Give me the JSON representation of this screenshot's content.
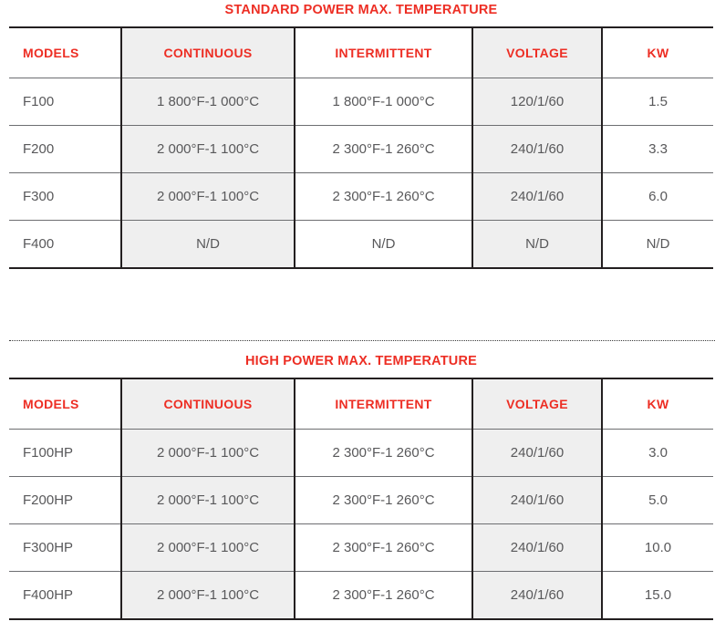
{
  "page": {
    "background": "#ffffff",
    "accent_red": "#ED2E24",
    "text_gray": "#58585A",
    "shaded_cell": "#EFEFEF",
    "border_dark": "#231F20"
  },
  "divider": {
    "style": "dotted"
  },
  "tables": [
    {
      "id": "standard",
      "title": "STANDARD POWER MAX. TEMPERATURE",
      "columns": [
        "MODELS",
        "CONTINUOUS",
        "INTERMITTENT",
        "VOLTAGE",
        "KW"
      ],
      "rows": [
        {
          "model": "F100",
          "continuous": "1 800°F-1 000°C",
          "intermittent": "1 800°F-1 000°C",
          "voltage": "120/1/60",
          "kw": "1.5"
        },
        {
          "model": "F200",
          "continuous": "2 000°F-1 100°C",
          "intermittent": "2 300°F-1 260°C",
          "voltage": "240/1/60",
          "kw": "3.3"
        },
        {
          "model": "F300",
          "continuous": "2 000°F-1 100°C",
          "intermittent": "2 300°F-1 260°C",
          "voltage": "240/1/60",
          "kw": "6.0"
        },
        {
          "model": "F400",
          "continuous": "N/D",
          "intermittent": "N/D",
          "voltage": "N/D",
          "kw": "N/D"
        }
      ]
    },
    {
      "id": "high",
      "title": "HIGH POWER MAX. TEMPERATURE",
      "columns": [
        "MODELS",
        "CONTINUOUS",
        "INTERMITTENT",
        "VOLTAGE",
        "KW"
      ],
      "rows": [
        {
          "model": "F100HP",
          "continuous": "2 000°F-1 100°C",
          "intermittent": "2 300°F-1 260°C",
          "voltage": "240/1/60",
          "kw": "3.0"
        },
        {
          "model": "F200HP",
          "continuous": "2 000°F-1 100°C",
          "intermittent": "2 300°F-1 260°C",
          "voltage": "240/1/60",
          "kw": "5.0"
        },
        {
          "model": "F300HP",
          "continuous": "2 000°F-1 100°C",
          "intermittent": "2 300°F-1 260°C",
          "voltage": "240/1/60",
          "kw": "10.0"
        },
        {
          "model": "F400HP",
          "continuous": "2 000°F-1 100°C",
          "intermittent": "2 300°F-1 260°C",
          "voltage": "240/1/60",
          "kw": "15.0"
        }
      ]
    }
  ]
}
